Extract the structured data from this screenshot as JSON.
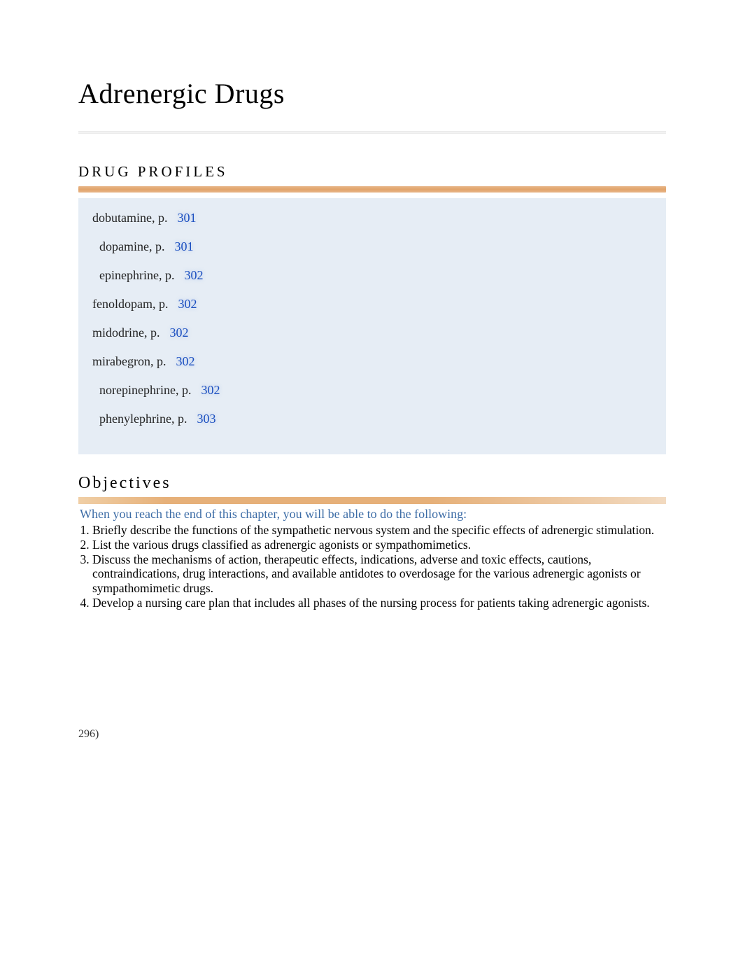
{
  "title": "Adrenergic Drugs",
  "drug_profiles_heading": "DRUG PROFILES",
  "drugs": [
    {
      "label": "dobutamine, p.",
      "page": "301",
      "indent": "ind-a"
    },
    {
      "label": "dopamine, p.",
      "page": "301",
      "indent": "ind-b"
    },
    {
      "label": "epinephrine, p.",
      "page": "302",
      "indent": "ind-b"
    },
    {
      "label": "fenoldopam, p.",
      "page": "302",
      "indent": "ind-a"
    },
    {
      "label": "midodrine, p.",
      "page": "302",
      "indent": "ind-a"
    },
    {
      "label": "mirabegron, p.",
      "page": "302",
      "indent": "ind-a"
    },
    {
      "label": "norepinephrine, p.",
      "page": "302",
      "indent": "ind-b"
    },
    {
      "label": "phenylephrine, p.",
      "page": "303",
      "indent": "ind-b"
    }
  ],
  "objectives_heading": "Objectives",
  "objectives_lead": "When you reach the end of this chapter, you will be able to do the following:",
  "objectives": [
    "Briefly describe the functions of the sympathetic nervous system and the specific effects of adrenergic stimulation.",
    "List the various drugs classified as adrenergic agonists or sympathomimetics.",
    "Discuss the mechanisms of action, therapeutic effects, indications, adverse and toxic effects, cautions, contraindications, drug interactions, and available antidotes to overdosage for the various adrenergic agonists or sympathomimetic drugs.",
    "Develop a nursing care plan that includes all phases of the nursing process for patients taking adrenergic agonists."
  ],
  "stray_text": "296)"
}
